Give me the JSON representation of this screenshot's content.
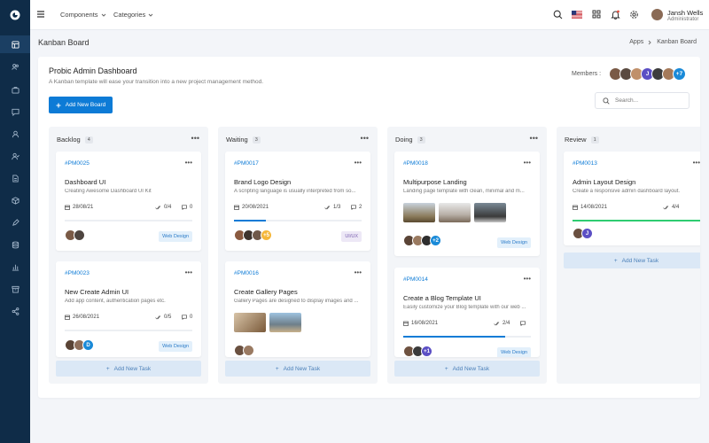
{
  "topbar": {
    "nav": [
      {
        "label": "Components"
      },
      {
        "label": "Categories"
      }
    ],
    "user": {
      "name": "Jansh Wells",
      "role": "Administrator"
    }
  },
  "page": {
    "title": "Kanban Board",
    "breadcrumb": [
      "Apps",
      "Kanban Board"
    ]
  },
  "board": {
    "title": "Probic Admin Dashboard",
    "subtitle": "A Kanban template will ease your transition into a new project management method.",
    "add_board_label": "Add New Board",
    "members_label": "Members :",
    "members": [
      {
        "initial": "",
        "color": "#7a5a46"
      },
      {
        "initial": "",
        "color": "#5a4a40"
      },
      {
        "initial": "",
        "color": "#c0906a"
      },
      {
        "initial": "J",
        "color": "#5b4fc4"
      },
      {
        "initial": "",
        "color": "#3d3d3d"
      },
      {
        "initial": "",
        "color": "#a57a5a"
      },
      {
        "initial": "+7",
        "color": "#1a8ad8"
      }
    ],
    "search_placeholder": "Search..."
  },
  "columns": [
    {
      "name": "Backlog",
      "count": "4",
      "cards": [
        {
          "id": "#PM0025",
          "title": "Dashboard UI",
          "desc": "Creating Awesome Dashboard UI Kit",
          "date": "28/08/21",
          "tasks": "0/4",
          "comments": "0",
          "tag": "Web Design",
          "progress": 0
        },
        {
          "id": "#PM0023",
          "title": "New Create Admin UI",
          "desc": "Add app content, authentication pages etc.",
          "date": "26/08/2021",
          "tasks": "0/5",
          "comments": "0",
          "tag": "Web Design",
          "progress": 0,
          "avatar_letter": "D"
        }
      ],
      "add_task_label": "Add New Task"
    },
    {
      "name": "Waiting",
      "count": "3",
      "cards": [
        {
          "id": "#PM0017",
          "title": "Brand Logo Design",
          "desc": "A scripting language is usually interpreted from so...",
          "date": "20/08/2021",
          "tasks": "1/3",
          "comments": "2",
          "tag": "UI/UX",
          "progress": 0.25,
          "avatar_extra": "+5"
        },
        {
          "id": "#PM0016",
          "title": "Create Gallery Pages",
          "desc": "Gallery Pages are designed to display images and ..."
        }
      ],
      "add_task_label": "Add New Task"
    },
    {
      "name": "Doing",
      "count": "3",
      "cards": [
        {
          "id": "#PM0018",
          "title": "Multipurpose Landing",
          "desc": "Landing page template with clean, minimal and m...",
          "tag": "Web Design",
          "avatar_extra": "+2"
        },
        {
          "id": "#PM0014",
          "title": "Create a Blog Template UI",
          "desc": "Easily customize your Blog template with our web ...",
          "date": "16/08/2021",
          "tasks": "2/4",
          "comments": "",
          "tag": "Web Design",
          "progress": 0.8,
          "avatar_extra": "+1"
        }
      ],
      "add_task_label": "Add New Task"
    },
    {
      "name": "Review",
      "count": "1",
      "cards": [
        {
          "id": "#PM0013",
          "title": "Admin Layout Design",
          "desc": "Create a responsive admin dashboard layout.",
          "date": "14/08/2021",
          "tasks": "4/4",
          "tag": "UI",
          "progress": 1,
          "avatar_letter": "J"
        }
      ],
      "add_task_label": "Add New Task"
    }
  ],
  "colors": {
    "primary": "#0d7bd6",
    "sidebar": "#0f2c48",
    "success": "#2ecc71",
    "warning": "#f5b73b"
  }
}
